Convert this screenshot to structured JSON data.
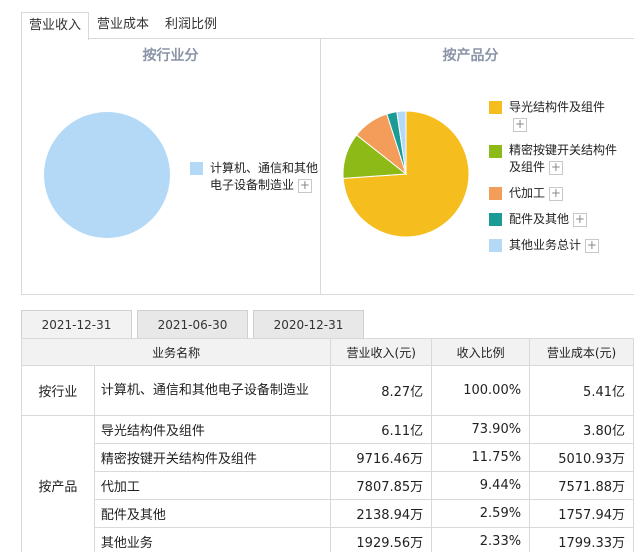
{
  "top_tabs": [
    {
      "label": "营业收入",
      "active": true
    },
    {
      "label": "营业成本",
      "active": false
    },
    {
      "label": "利润比例",
      "active": false
    }
  ],
  "charts": {
    "industry_title": "按行业分",
    "product_title": "按产品分"
  },
  "chart_data": [
    {
      "type": "pie",
      "title": "按行业分",
      "categories": [
        "计算机、通信和其他电子设备制造业"
      ],
      "values": [
        100.0
      ],
      "colors": [
        "#b3d9f7"
      ]
    },
    {
      "type": "pie",
      "title": "按产品分",
      "categories": [
        "导光结构件及组件",
        "精密按键开关结构件及组件",
        "代加工",
        "配件及其他",
        "其他业务总计"
      ],
      "values": [
        73.9,
        11.75,
        9.44,
        2.59,
        2.33
      ],
      "colors": [
        "#f5be1e",
        "#8dba17",
        "#f49c5a",
        "#1b9b96",
        "#b3d9f7"
      ]
    }
  ],
  "legend_industry": [
    {
      "line1": "计算机、通信和其他",
      "line2": "电子设备制造业",
      "color": "#b3d9f7"
    }
  ],
  "legend_product": [
    {
      "line1": "导光结构件及组件",
      "line2": "",
      "color": "#f5be1e"
    },
    {
      "line1": "精密按键开关结构件",
      "line2": "及组件",
      "color": "#8dba17"
    },
    {
      "line1": "代加工",
      "line2": "",
      "color": "#f49c5a"
    },
    {
      "line1": "配件及其他",
      "line2": "",
      "color": "#1b9b96"
    },
    {
      "line1": "其他业务总计",
      "line2": "",
      "color": "#b3d9f7"
    }
  ],
  "plus_symbol": "+",
  "date_tabs": [
    {
      "label": "2021-12-31",
      "active": true
    },
    {
      "label": "2021-06-30",
      "active": false
    },
    {
      "label": "2020-12-31",
      "active": false
    }
  ],
  "table": {
    "headers": [
      "业务名称",
      "营业收入(元)",
      "收入比例",
      "营业成本(元)"
    ],
    "groups": [
      {
        "segment": "按行业",
        "rows": [
          {
            "name": "计算机、通信和其他电子设备制造业",
            "revenue": "8.27亿",
            "ratio": "100.00%",
            "cost": "5.41亿"
          }
        ]
      },
      {
        "segment": "按产品",
        "rows": [
          {
            "name": "导光结构件及组件",
            "revenue": "6.11亿",
            "ratio": "73.90%",
            "cost": "3.80亿"
          },
          {
            "name": "精密按键开关结构件及组件",
            "revenue": "9716.46万",
            "ratio": "11.75%",
            "cost": "5010.93万"
          },
          {
            "name": "代加工",
            "revenue": "7807.85万",
            "ratio": "9.44%",
            "cost": "7571.88万"
          },
          {
            "name": "配件及其他",
            "revenue": "2138.94万",
            "ratio": "2.59%",
            "cost": "1757.94万"
          },
          {
            "name": "其他业务",
            "revenue": "1929.56万",
            "ratio": "2.33%",
            "cost": "1799.33万"
          }
        ]
      }
    ]
  }
}
